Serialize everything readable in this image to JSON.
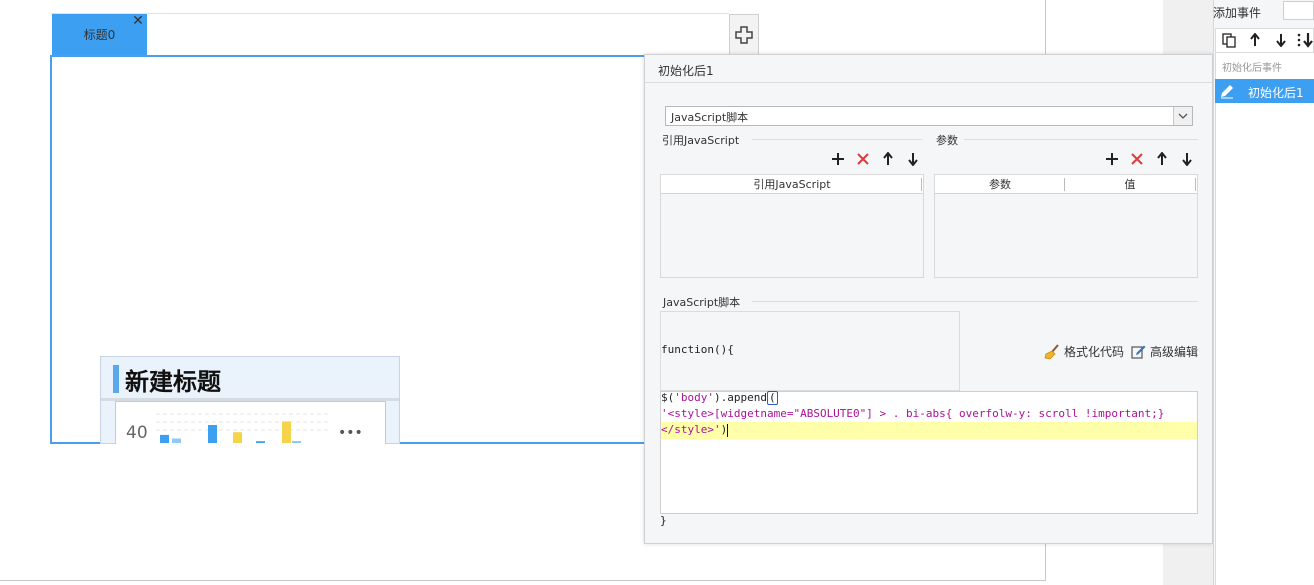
{
  "tabs": {
    "active_label": "标题0",
    "close_glyph": "✕"
  },
  "widget": {
    "title": "新建标题",
    "chart_axis_value": "40",
    "more_glyph": "•••"
  },
  "chart_data": {
    "type": "bar",
    "categories": [
      "",
      "",
      "",
      "",
      "",
      ""
    ],
    "series": [
      {
        "values": [
          9,
          20,
          2,
          24
        ]
      },
      {
        "values": [
          5,
          12,
          0
        ]
      }
    ]
  },
  "panel": {
    "title": "初始化后1",
    "script_type": "JavaScript脚本",
    "ref_section_label": "引用JavaScript",
    "params_section_label": "参数",
    "ref_table": {
      "columns": [
        "引用JavaScript"
      ]
    },
    "params_table": {
      "columns": [
        "参数",
        "值"
      ]
    },
    "script_section_label": "JavaScript脚本",
    "code_header": "function(){",
    "code_line1_a": "$(",
    "code_line1_b": "'body'",
    "code_line1_c": ").append",
    "code_line1_d": "(",
    "code_line2": "'<style>[widgetname=\"ABSOLUTE0\"] > . bi-abs{ overfolw-y: scroll !important;}",
    "code_line3_a": "</style>'",
    "code_line3_b": ")",
    "code_footer": "}",
    "format_button": "格式化代码",
    "advanced_button": "高级编辑"
  },
  "sidebar": {
    "add_event_label": "添加事件",
    "group_label": "初始化后事件",
    "items": [
      {
        "label": "初始化后1"
      }
    ]
  },
  "colors": {
    "accent": "#3d9ff2",
    "delete_red": "#e03b3b",
    "string_magenta": "#aa1199",
    "highlight_yellow": "#ffffaa"
  }
}
